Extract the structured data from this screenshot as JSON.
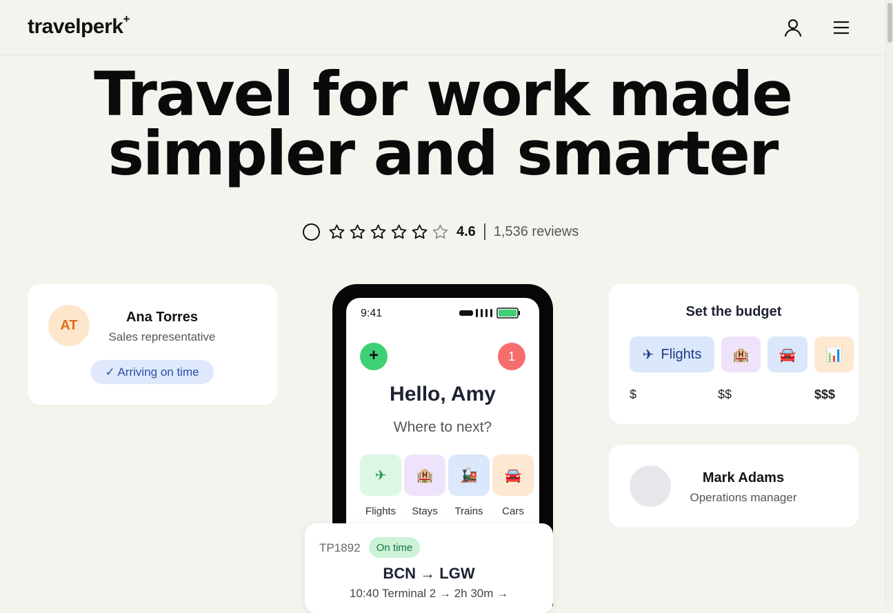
{
  "header": {
    "logo": "travelperk",
    "logo_mark": "+",
    "icons": [
      "user-icon",
      "menu-icon"
    ]
  },
  "hero": {
    "title_line1": "Travel for work made",
    "title_line2": "simpler and smarter"
  },
  "rating": {
    "stars_filled": 5,
    "score": "4.6",
    "reviews": "1,536 reviews"
  },
  "traveler_card": {
    "initials": "AT",
    "name": "Ana Torres",
    "role": "Sales representative",
    "badge": "✓ Arriving on time"
  },
  "phone": {
    "time": "9:41",
    "plus_label": "+",
    "notification_count": "1",
    "greeting": "Hello, Amy",
    "subtitle": "Where to next?",
    "categories": [
      {
        "label": "Flights",
        "icon": "plane-icon"
      },
      {
        "label": "Stays",
        "icon": "hotel-icon"
      },
      {
        "label": "Trains",
        "icon": "train-icon"
      },
      {
        "label": "Cars",
        "icon": "car-icon"
      }
    ]
  },
  "flight_card": {
    "flight_number": "TP1892",
    "status": "On time",
    "route": "BCN → LGW",
    "detail": "10:40 Terminal 2 → 2h 30m →"
  },
  "budget_card": {
    "title": "Set the budget",
    "chips": [
      {
        "label": "Flights",
        "icon": "plane-icon"
      },
      {
        "icon": "hotel-icon"
      },
      {
        "icon": "car-icon"
      },
      {
        "icon": "chart-icon"
      }
    ],
    "price_levels": [
      "$",
      "$$",
      "$$$"
    ]
  },
  "manager_card": {
    "name": "Mark Adams",
    "role": "Operations manager"
  },
  "colors": {
    "background": "#f4f4ef",
    "green_accent": "#3fcf74",
    "notification_red": "#f56d6d",
    "badge_blue": "#dfe9fb",
    "initials_orange": "#e07018"
  }
}
